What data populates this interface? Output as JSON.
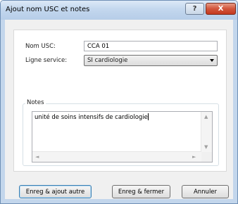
{
  "window": {
    "title": "Ajout nom USC et notes",
    "help_glyph": "?",
    "close_glyph": "X"
  },
  "form": {
    "name_label": "Nom USC:",
    "name_value": "CCA 01",
    "service_label": "Ligne service:",
    "service_value": "SI cardiologie"
  },
  "notes": {
    "group_label": "Notes",
    "text": "unité de soins intensifs de cardiologie"
  },
  "buttons": {
    "save_add": "Enreg & ajout autre",
    "save_close": "Enreg & fermer",
    "cancel": "Annuler"
  },
  "icons": {
    "scroll_up": "▲",
    "scroll_down": "▼",
    "scroll_left": "◄",
    "scroll_right": "►"
  }
}
